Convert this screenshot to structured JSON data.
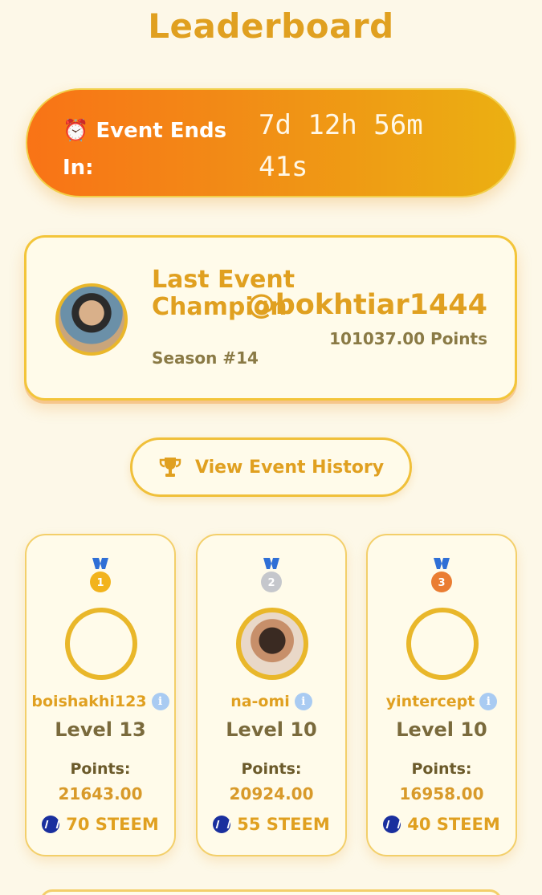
{
  "page": {
    "title": "Leaderboard"
  },
  "timer": {
    "label": "⏰ Event Ends In:",
    "value": "7d 12h 56m 41s"
  },
  "champion": {
    "heading": "Last Event Champion",
    "season": "Season #14",
    "username": "@bokhtiar1444",
    "points": "101037.00 Points"
  },
  "history_button": {
    "label": "View Event History",
    "icon": "trophy-icon"
  },
  "podium": [
    {
      "rank": 1,
      "medal": "gold-medal-icon",
      "username": "boishakhi123",
      "level": "Level 13",
      "points_label": "Points:",
      "points": "21643.00",
      "reward": "70 STEEM",
      "medal_color": "#f2b31c"
    },
    {
      "rank": 2,
      "medal": "silver-medal-icon",
      "username": "na-omi",
      "level": "Level 10",
      "points_label": "Points:",
      "points": "20924.00",
      "reward": "55 STEEM",
      "medal_color": "#c5c7cc"
    },
    {
      "rank": 3,
      "medal": "bronze-medal-icon",
      "username": "yintercept",
      "level": "Level 10",
      "points_label": "Points:",
      "points": "16958.00",
      "reward": "40 STEEM",
      "medal_color": "#ea7d32"
    }
  ]
}
